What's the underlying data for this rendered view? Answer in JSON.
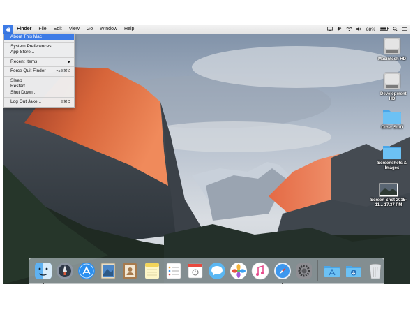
{
  "menubar": {
    "app_name": "Finder",
    "items": [
      "File",
      "Edit",
      "View",
      "Go",
      "Window",
      "Help"
    ],
    "battery": "88%"
  },
  "apple_menu": {
    "items": [
      {
        "label": "About This Mac",
        "shortcut": "",
        "highlighted": true
      },
      {
        "label": "System Preferences...",
        "shortcut": ""
      },
      {
        "label": "App Store...",
        "shortcut": ""
      },
      {
        "label": "Recent Items",
        "shortcut": "▶"
      },
      {
        "label": "Force Quit Finder",
        "shortcut": "⌥⇧⌘⎋"
      },
      {
        "label": "Sleep",
        "shortcut": ""
      },
      {
        "label": "Restart...",
        "shortcut": ""
      },
      {
        "label": "Shut Down...",
        "shortcut": ""
      },
      {
        "label": "Log Out Jake...",
        "shortcut": "⇧⌘Q"
      }
    ]
  },
  "desktop": {
    "icons": [
      {
        "label": "Macintosh HD",
        "icon": "hard-drive-icon"
      },
      {
        "label": "Development HD",
        "icon": "hard-drive-icon"
      },
      {
        "label": "Other Stuff",
        "icon": "folder-icon"
      },
      {
        "label": "Screenshots & Images",
        "icon": "folder-icon"
      },
      {
        "label": "Screen Shot 2015-11... 17.37 PM",
        "icon": "screenshot-file-icon"
      }
    ]
  },
  "dock": {
    "apps": [
      "finder-icon",
      "launchpad-icon",
      "app-store-icon",
      "mail-stamp-icon",
      "contacts-icon",
      "notes-icon",
      "reminders-icon",
      "calendar-icon",
      "messages-icon",
      "photos-icon",
      "itunes-icon",
      "safari-icon",
      "system-preferences-icon"
    ],
    "right": [
      "applications-folder-icon",
      "downloads-folder-icon",
      "trash-icon"
    ]
  },
  "colors": {
    "menu_highlight": "#3d7be6",
    "folder": "#5bb4f0"
  }
}
